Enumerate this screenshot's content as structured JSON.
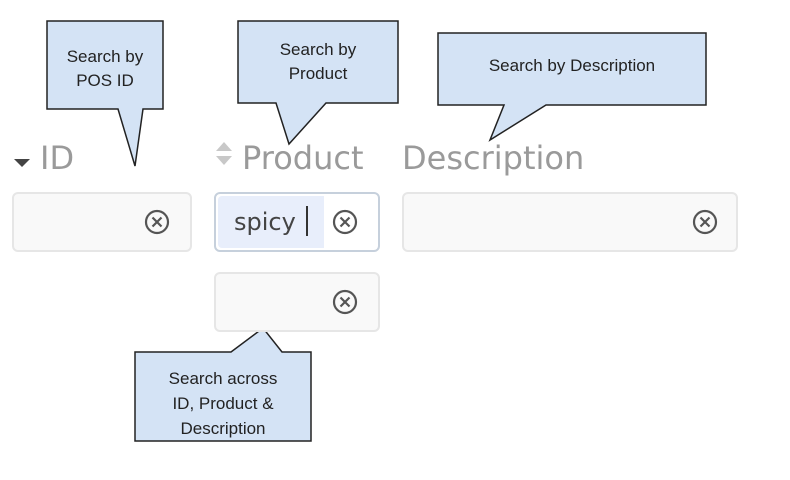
{
  "columns": {
    "id": {
      "label": "ID",
      "sort_icon": "sort-desc-icon"
    },
    "product": {
      "label": "Product",
      "sort_icon": "sort-both-icon"
    },
    "description": {
      "label": "Description"
    }
  },
  "filters": {
    "id": {
      "value": "",
      "clear_icon": "clear-circle-icon"
    },
    "product": {
      "value": "spicy",
      "clear_icon": "clear-circle-icon"
    },
    "description": {
      "value": "",
      "clear_icon": "clear-circle-icon"
    },
    "global": {
      "value": "",
      "clear_icon": "clear-circle-icon"
    }
  },
  "callouts": {
    "id": "Search by\nPOS ID",
    "product": "Search by\nProduct",
    "description": "Search by Description",
    "global": "Search across\nID, Product &\nDescription"
  },
  "colors": {
    "callout_fill": "#d4e3f5",
    "callout_stroke": "#222222",
    "header_text": "#9a9a9a",
    "selection": "#e8eefb"
  }
}
